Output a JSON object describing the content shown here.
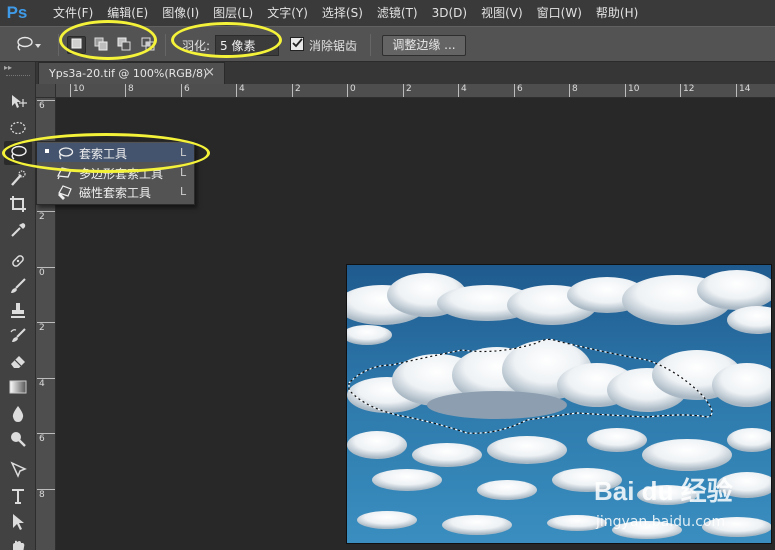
{
  "app": {
    "logo": "Ps",
    "menus": [
      "文件(F)",
      "编辑(E)",
      "图像(I)",
      "图层(L)",
      "文字(Y)",
      "选择(S)",
      "滤镜(T)",
      "3D(D)",
      "视图(V)",
      "窗口(W)",
      "帮助(H)"
    ]
  },
  "options_bar": {
    "tool_icon": "lasso-icon",
    "selection_modes": [
      {
        "name": "new-selection",
        "active": true
      },
      {
        "name": "add-to-selection",
        "active": false
      },
      {
        "name": "subtract-from-selection",
        "active": false
      },
      {
        "name": "intersect-with-selection",
        "active": false
      }
    ],
    "feather_label": "羽化:",
    "feather_value": "5 像素",
    "antialias_label": "消除锯齿",
    "antialias_checked": true,
    "refine_edge_label": "调整边缘 ..."
  },
  "document": {
    "tab_title": "Yps3a-20.tif @ 100%(RGB/8)",
    "close_glyph": "×"
  },
  "rulers": {
    "horizontal_labels": [
      "10",
      "8",
      "6",
      "4",
      "2",
      "0",
      "2",
      "4",
      "6",
      "8",
      "10",
      "12",
      "14"
    ],
    "vertical_labels": [
      "6",
      "4",
      "2",
      "0",
      "2",
      "4",
      "6",
      "8"
    ]
  },
  "tools": [
    {
      "name": "move-tool",
      "icon": "move-icon"
    },
    {
      "name": "marquee-tool",
      "icon": "elliptical-marquee-icon"
    },
    {
      "name": "lasso-tool",
      "icon": "lasso-icon",
      "active": true
    },
    {
      "name": "quick-selection-tool",
      "icon": "quick-selection-icon"
    },
    {
      "name": "crop-tool",
      "icon": "crop-icon"
    },
    {
      "name": "eyedropper-tool",
      "icon": "eyedropper-icon"
    },
    {
      "name": "spot-healing-tool",
      "icon": "healing-icon"
    },
    {
      "name": "brush-tool",
      "icon": "brush-icon"
    },
    {
      "name": "clone-stamp-tool",
      "icon": "stamp-icon"
    },
    {
      "name": "history-brush-tool",
      "icon": "history-brush-icon"
    },
    {
      "name": "eraser-tool",
      "icon": "eraser-icon"
    },
    {
      "name": "gradient-tool",
      "icon": "gradient-icon"
    },
    {
      "name": "blur-tool",
      "icon": "blur-drop-icon"
    },
    {
      "name": "dodge-tool",
      "icon": "dodge-icon"
    },
    {
      "name": "pen-tool",
      "icon": "pen-icon"
    },
    {
      "name": "type-tool",
      "icon": "type-icon"
    },
    {
      "name": "path-selection-tool",
      "icon": "path-selection-icon"
    },
    {
      "name": "hand-tool",
      "icon": "hand-icon"
    }
  ],
  "lasso_flyout": {
    "items": [
      {
        "label": "套索工具",
        "shortcut": "L",
        "icon": "lasso-icon",
        "selected": true
      },
      {
        "label": "多边形套索工具",
        "shortcut": "L",
        "icon": "polygonal-lasso-icon",
        "selected": false
      },
      {
        "label": "磁性套索工具",
        "shortcut": "L",
        "icon": "magnetic-lasso-icon",
        "selected": false
      }
    ]
  },
  "watermark": {
    "brand": "Bai du 经验",
    "url": "jingyan.baidu.com"
  },
  "colors": {
    "menubar_bg": "#3a3a3a",
    "optbar_bg": "#535353",
    "canvas_bg": "#282828",
    "ps_blue": "#3f9be8",
    "annotation_yellow": "#f5f23a",
    "flyout_selected": "#44546e"
  }
}
